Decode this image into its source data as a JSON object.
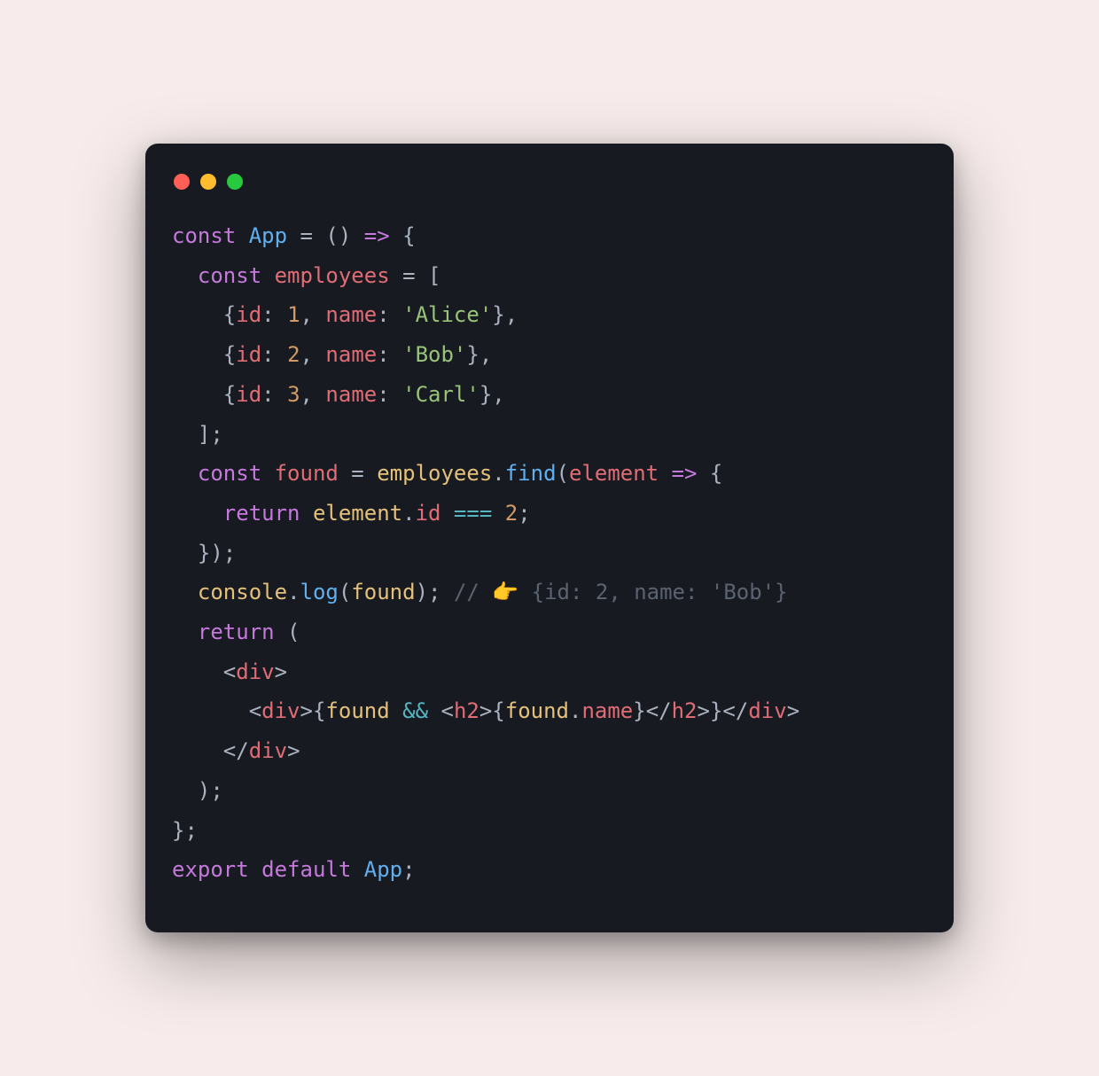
{
  "traffic_lights": [
    "close",
    "minimize",
    "maximize"
  ],
  "code": {
    "line1": [
      {
        "cls": "kw",
        "t": "const"
      },
      {
        "cls": "pun",
        "t": " "
      },
      {
        "cls": "fn",
        "t": "App"
      },
      {
        "cls": "pun",
        "t": " "
      },
      {
        "cls": "pun",
        "t": "="
      },
      {
        "cls": "pun",
        "t": " () "
      },
      {
        "cls": "kw",
        "t": "=>"
      },
      {
        "cls": "pun",
        "t": " {"
      }
    ],
    "line2": [
      {
        "cls": "pun",
        "t": "  "
      },
      {
        "cls": "kw",
        "t": "const"
      },
      {
        "cls": "pun",
        "t": " "
      },
      {
        "cls": "decl",
        "t": "employees"
      },
      {
        "cls": "pun",
        "t": " = ["
      }
    ],
    "line3": [
      {
        "cls": "pun",
        "t": "    {"
      },
      {
        "cls": "prop",
        "t": "id"
      },
      {
        "cls": "pun",
        "t": ": "
      },
      {
        "cls": "num",
        "t": "1"
      },
      {
        "cls": "pun",
        "t": ", "
      },
      {
        "cls": "prop",
        "t": "name"
      },
      {
        "cls": "pun",
        "t": ": "
      },
      {
        "cls": "str",
        "t": "'Alice'"
      },
      {
        "cls": "pun",
        "t": "},"
      }
    ],
    "line4": [
      {
        "cls": "pun",
        "t": "    {"
      },
      {
        "cls": "prop",
        "t": "id"
      },
      {
        "cls": "pun",
        "t": ": "
      },
      {
        "cls": "num",
        "t": "2"
      },
      {
        "cls": "pun",
        "t": ", "
      },
      {
        "cls": "prop",
        "t": "name"
      },
      {
        "cls": "pun",
        "t": ": "
      },
      {
        "cls": "str",
        "t": "'Bob'"
      },
      {
        "cls": "pun",
        "t": "},"
      }
    ],
    "line5": [
      {
        "cls": "pun",
        "t": "    {"
      },
      {
        "cls": "prop",
        "t": "id"
      },
      {
        "cls": "pun",
        "t": ": "
      },
      {
        "cls": "num",
        "t": "3"
      },
      {
        "cls": "pun",
        "t": ", "
      },
      {
        "cls": "prop",
        "t": "name"
      },
      {
        "cls": "pun",
        "t": ": "
      },
      {
        "cls": "str",
        "t": "'Carl'"
      },
      {
        "cls": "pun",
        "t": "},"
      }
    ],
    "line6": [
      {
        "cls": "pun",
        "t": "  ];"
      }
    ],
    "line7": [
      {
        "cls": "pun",
        "t": "  "
      },
      {
        "cls": "kw",
        "t": "const"
      },
      {
        "cls": "pun",
        "t": " "
      },
      {
        "cls": "decl",
        "t": "found"
      },
      {
        "cls": "pun",
        "t": " = "
      },
      {
        "cls": "var",
        "t": "employees"
      },
      {
        "cls": "pun",
        "t": "."
      },
      {
        "cls": "fn",
        "t": "find"
      },
      {
        "cls": "pun",
        "t": "("
      },
      {
        "cls": "decl",
        "t": "element"
      },
      {
        "cls": "pun",
        "t": " "
      },
      {
        "cls": "kw",
        "t": "=>"
      },
      {
        "cls": "pun",
        "t": " {"
      }
    ],
    "line8": [
      {
        "cls": "pun",
        "t": "    "
      },
      {
        "cls": "kw",
        "t": "return"
      },
      {
        "cls": "pun",
        "t": " "
      },
      {
        "cls": "var",
        "t": "element"
      },
      {
        "cls": "pun",
        "t": "."
      },
      {
        "cls": "prop",
        "t": "id"
      },
      {
        "cls": "pun",
        "t": " "
      },
      {
        "cls": "op",
        "t": "==="
      },
      {
        "cls": "pun",
        "t": " "
      },
      {
        "cls": "num",
        "t": "2"
      },
      {
        "cls": "pun",
        "t": ";"
      }
    ],
    "line9": [
      {
        "cls": "pun",
        "t": "  });"
      }
    ],
    "line10": [
      {
        "cls": "pun",
        "t": "  "
      },
      {
        "cls": "cns",
        "t": "console"
      },
      {
        "cls": "pun",
        "t": "."
      },
      {
        "cls": "fn",
        "t": "log"
      },
      {
        "cls": "pun",
        "t": "("
      },
      {
        "cls": "var",
        "t": "found"
      },
      {
        "cls": "pun",
        "t": "); "
      },
      {
        "cls": "cmt",
        "t": "// 👉️ {id: 2, name: 'Bob'}"
      }
    ],
    "line11": [
      {
        "cls": "pun",
        "t": "  "
      },
      {
        "cls": "kw",
        "t": "return"
      },
      {
        "cls": "pun",
        "t": " ("
      }
    ],
    "line12": [
      {
        "cls": "pun",
        "t": "    "
      },
      {
        "cls": "ang",
        "t": "<"
      },
      {
        "cls": "tag",
        "t": "div"
      },
      {
        "cls": "ang",
        "t": ">"
      }
    ],
    "line13": [
      {
        "cls": "pun",
        "t": "      "
      },
      {
        "cls": "ang",
        "t": "<"
      },
      {
        "cls": "tag",
        "t": "div"
      },
      {
        "cls": "ang",
        "t": ">"
      },
      {
        "cls": "pun",
        "t": "{"
      },
      {
        "cls": "var",
        "t": "found"
      },
      {
        "cls": "pun",
        "t": " "
      },
      {
        "cls": "op",
        "t": "&&"
      },
      {
        "cls": "pun",
        "t": " "
      },
      {
        "cls": "ang",
        "t": "<"
      },
      {
        "cls": "tag",
        "t": "h2"
      },
      {
        "cls": "ang",
        "t": ">"
      },
      {
        "cls": "pun",
        "t": "{"
      },
      {
        "cls": "var",
        "t": "found"
      },
      {
        "cls": "pun",
        "t": "."
      },
      {
        "cls": "prop",
        "t": "name"
      },
      {
        "cls": "pun",
        "t": "}"
      },
      {
        "cls": "ang",
        "t": "</"
      },
      {
        "cls": "tag",
        "t": "h2"
      },
      {
        "cls": "ang",
        "t": ">"
      },
      {
        "cls": "pun",
        "t": "}"
      },
      {
        "cls": "ang",
        "t": "</"
      },
      {
        "cls": "tag",
        "t": "div"
      },
      {
        "cls": "ang",
        "t": ">"
      }
    ],
    "line14": [
      {
        "cls": "pun",
        "t": "    "
      },
      {
        "cls": "ang",
        "t": "</"
      },
      {
        "cls": "tag",
        "t": "div"
      },
      {
        "cls": "ang",
        "t": ">"
      }
    ],
    "line15": [
      {
        "cls": "pun",
        "t": "  );"
      }
    ],
    "line16": [
      {
        "cls": "pun",
        "t": "};"
      }
    ],
    "line17": [
      {
        "cls": "kw",
        "t": "export"
      },
      {
        "cls": "pun",
        "t": " "
      },
      {
        "cls": "kw",
        "t": "default"
      },
      {
        "cls": "pun",
        "t": " "
      },
      {
        "cls": "fn",
        "t": "App"
      },
      {
        "cls": "pun",
        "t": ";"
      }
    ]
  }
}
